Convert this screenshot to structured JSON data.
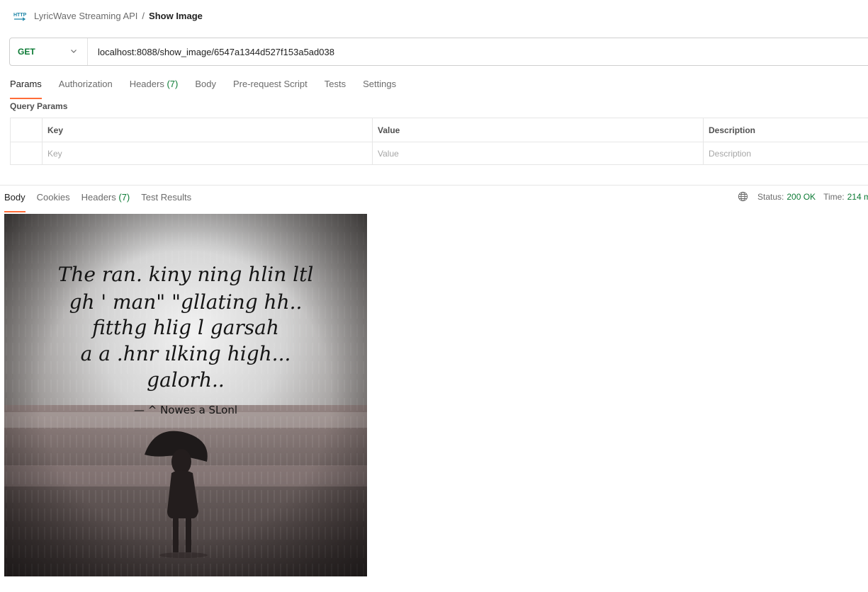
{
  "breadcrumb": {
    "icon": "http-icon",
    "collection": "LyricWave Streaming API",
    "separator": "/",
    "request": "Show Image"
  },
  "request": {
    "method": "GET",
    "url": "localhost:8088/show_image/6547a1344d527f153a5ad038"
  },
  "request_tabs": [
    {
      "label": "Params",
      "active": true
    },
    {
      "label": "Authorization"
    },
    {
      "label": "Headers",
      "count": "(7)"
    },
    {
      "label": "Body"
    },
    {
      "label": "Pre-request Script"
    },
    {
      "label": "Tests"
    },
    {
      "label": "Settings"
    }
  ],
  "query_params": {
    "title": "Query Params",
    "columns": [
      "Key",
      "Value",
      "Description"
    ],
    "placeholders": [
      "Key",
      "Value",
      "Description"
    ]
  },
  "response_tabs": [
    {
      "label": "Body",
      "active": true
    },
    {
      "label": "Cookies"
    },
    {
      "label": "Headers",
      "count": "(7)"
    },
    {
      "label": "Test Results"
    }
  ],
  "response_status": {
    "status_label": "Status:",
    "status_value": "200 OK",
    "time_label": "Time:",
    "time_value": "214 m"
  },
  "response_image": {
    "text_lines": [
      "The ran. kiny ning hlin ltl",
      "gh ' man\" \"gllating hh..",
      "fitthg hlig l garsah",
      "a a .hnr ılking high...",
      "galorh.."
    ],
    "signature": "— ^ Nowes a SLonl"
  },
  "colors": {
    "accent": "#ff6c37",
    "method_green": "#0b7a34",
    "status_green": "#0b7a34"
  }
}
